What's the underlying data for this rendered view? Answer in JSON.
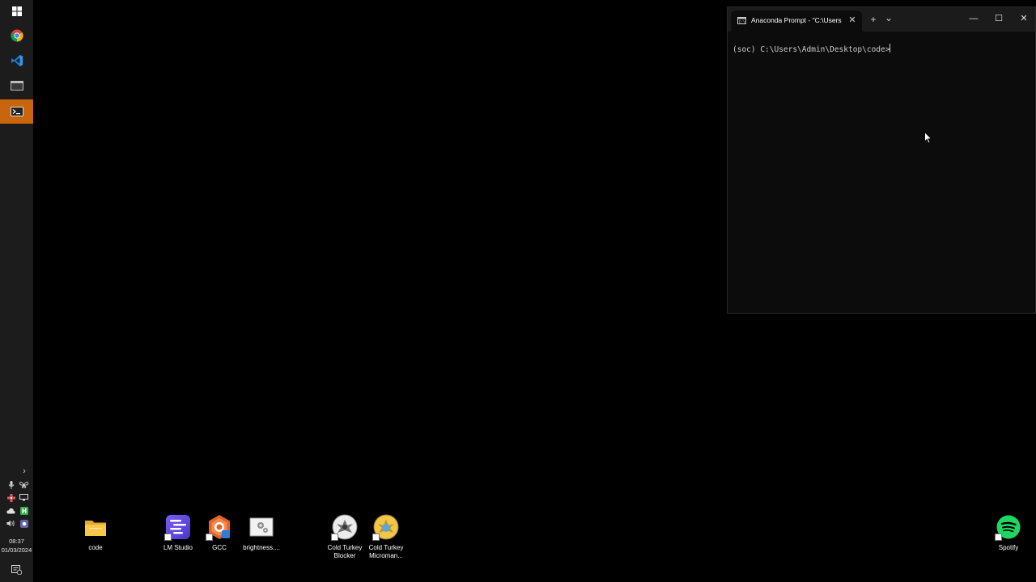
{
  "taskbar": {
    "apps": [
      {
        "name": "windows-start",
        "icon": "windows-logo-icon"
      },
      {
        "name": "chrome",
        "icon": "chrome-icon"
      },
      {
        "name": "vscode",
        "icon": "vscode-icon"
      },
      {
        "name": "window-app",
        "icon": "window-icon"
      },
      {
        "name": "terminal",
        "icon": "terminal-icon",
        "active": true
      }
    ],
    "clock": {
      "time": "08:37",
      "date": "01/03/2024"
    },
    "accent": "#c9650c"
  },
  "terminal": {
    "tab_title": "Anaconda Prompt - \"C:\\Users",
    "close_tab": "✕",
    "new_tab": "+",
    "dropdown": "⌄",
    "minimize": "—",
    "maximize": "☐",
    "close": "✕",
    "prompt_text": "(soc) C:\\Users\\Admin\\Desktop\\code>"
  },
  "desktop_icons": [
    {
      "label": "code",
      "icon": "folder-icon"
    },
    {
      "label": "LM Studio",
      "icon": "lm-studio-icon"
    },
    {
      "label": "GCC",
      "icon": "gcc-icon"
    },
    {
      "label": "brightness....",
      "icon": "settings-file-icon"
    },
    {
      "label": "Cold Turkey Blocker",
      "icon": "cold-turkey-blocker-icon"
    },
    {
      "label": "Cold Turkey Microman...",
      "icon": "cold-turkey-micromanager-icon"
    },
    {
      "label": "Spotify",
      "icon": "spotify-icon"
    }
  ]
}
